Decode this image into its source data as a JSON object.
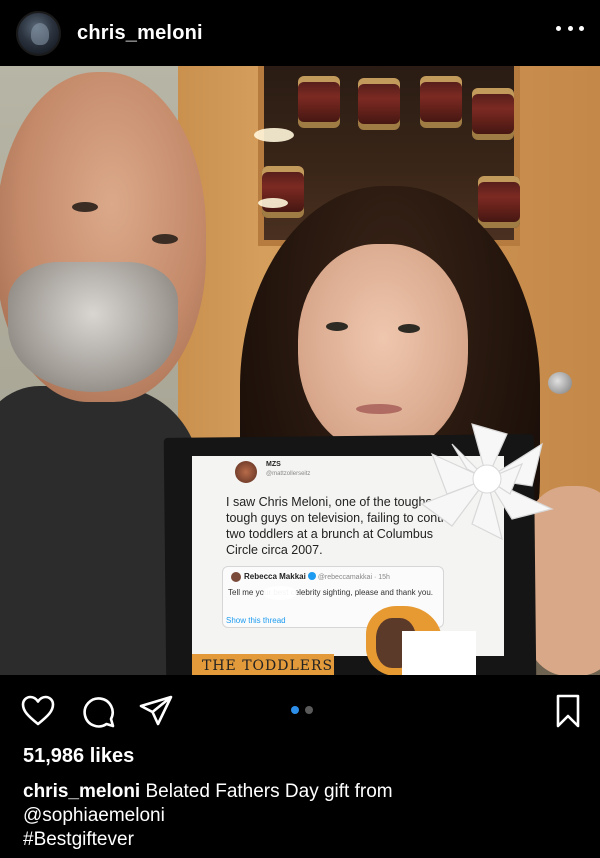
{
  "header": {
    "username": "chris_meloni"
  },
  "post": {
    "tweet": {
      "author_short": "MZS",
      "handle": "@mattzollerseitz",
      "text": "I saw Chris Meloni, one of the toughest tough guys on television, failing to control two toddlers at a brunch at Columbus Circle circa 2007.",
      "quoted": {
        "name": "Rebecca Makkai",
        "handle": "@rebeccamakkai · 15h",
        "text": "Tell me your best celebrity sighting, please and thank you.",
        "show_thread": "Show this thread"
      }
    },
    "sticker_text": "THE TODDLERS",
    "carousel": {
      "count": 2,
      "active_index": 0,
      "active_color": "#2d8eea"
    }
  },
  "actions": {
    "like_icon": "heart-icon",
    "comment_icon": "comment-icon",
    "share_icon": "send-icon",
    "save_icon": "bookmark-icon"
  },
  "likes": "51,986 likes",
  "caption": {
    "user": "chris_meloni",
    "text": "Belated Fathers Day gift  from",
    "mention": "@sophiaemeloni",
    "hashtag": "#Bestgiftever"
  }
}
